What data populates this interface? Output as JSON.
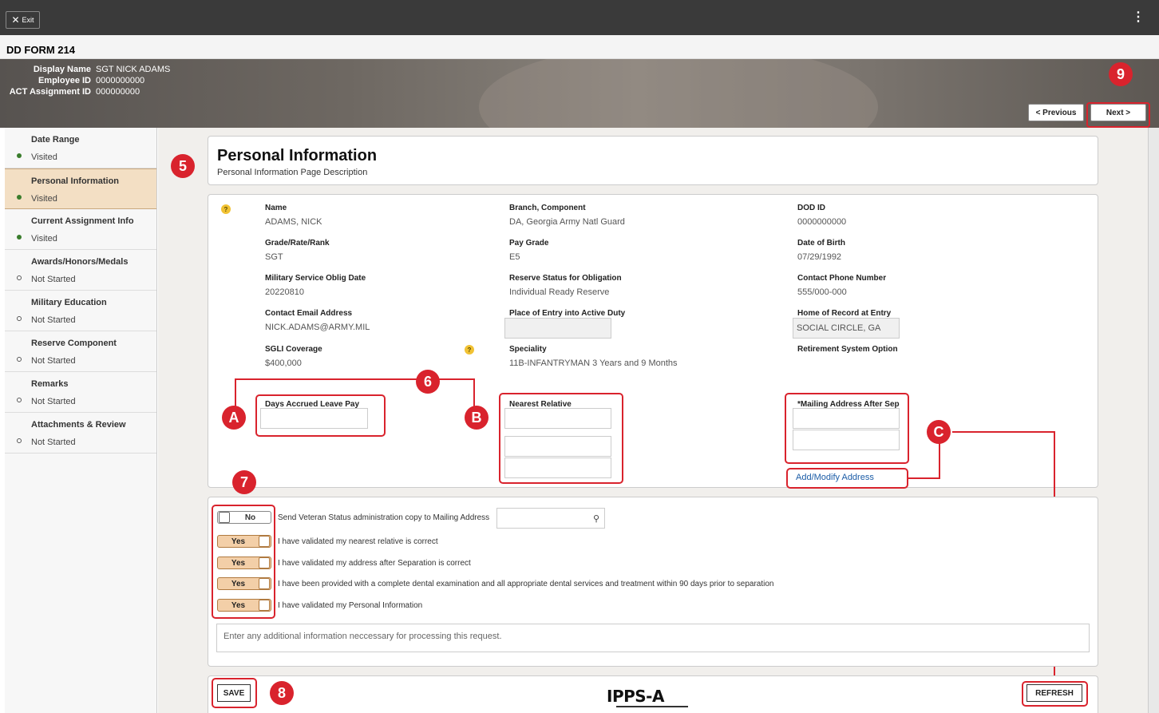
{
  "topbar": {
    "exit_label": "Exit",
    "menu_glyph": "⋮"
  },
  "form_title": "DD FORM 214",
  "employee": {
    "rows": [
      {
        "label": "Display Name",
        "value": "SGT NICK ADAMS"
      },
      {
        "label": "Employee ID",
        "value": "0000000000"
      },
      {
        "label": "ACT Assignment ID",
        "value": "000000000"
      }
    ]
  },
  "nav": {
    "previous_label": "< Previous",
    "next_label": "Next >"
  },
  "steps": [
    {
      "name": "Date Range",
      "status": "Visited"
    },
    {
      "name": "Personal Information",
      "status": "Visited"
    },
    {
      "name": "Current Assignment Info",
      "status": "Visited"
    },
    {
      "name": "Awards/Honors/Medals",
      "status": "Not Started"
    },
    {
      "name": "Military Education",
      "status": "Not Started"
    },
    {
      "name": "Reserve Component",
      "status": "Not Started"
    },
    {
      "name": "Remarks",
      "status": "Not Started"
    },
    {
      "name": "Attachments & Review",
      "status": "Not Started"
    }
  ],
  "page": {
    "title": "Personal Information",
    "description": "Personal Information Page Description"
  },
  "fields": {
    "name": {
      "label": "Name",
      "value": "ADAMS, NICK"
    },
    "branch": {
      "label": "Branch, Component",
      "value": "DA, Georgia Army Natl Guard"
    },
    "dodid": {
      "label": "DOD ID",
      "value": "0000000000"
    },
    "grade": {
      "label": "Grade/Rate/Rank",
      "value": "SGT"
    },
    "paygrade": {
      "label": "Pay Grade",
      "value": "E5"
    },
    "dob": {
      "label": "Date of Birth",
      "value": "07/29/1992"
    },
    "msod": {
      "label": "Military Service Oblig Date",
      "value": "20220810"
    },
    "reserve_status": {
      "label": "Reserve Status for Obligation",
      "value": "Individual Ready Reserve"
    },
    "phone": {
      "label": "Contact Phone Number",
      "value": "555/000-000"
    },
    "email": {
      "label": "Contact Email Address",
      "value": "NICK.ADAMS@ARMY.MIL"
    },
    "place_entry": {
      "label": "Place of Entry into Active Duty",
      "value": ""
    },
    "home_record": {
      "label": "Home of Record at Entry",
      "value": "SOCIAL CIRCLE, GA"
    },
    "sgli": {
      "label": "SGLI Coverage",
      "value": "$400,000"
    },
    "speciality": {
      "label": "Speciality",
      "value": "11B-INFANTRYMAN 3 Years and 9 Months"
    },
    "retirement": {
      "label": "Retirement System Option",
      "value": ""
    },
    "leave": {
      "label": "Days Accrued Leave Pay"
    },
    "relative": {
      "label": "Nearest Relative"
    },
    "mailing": {
      "label": "*Mailing Address After Sep"
    },
    "add_address_link": "Add/Modify Address"
  },
  "checks": [
    {
      "state": "No",
      "label": "Send Veteran Status administration copy to Mailing Address"
    },
    {
      "state": "Yes",
      "label": "I have validated my nearest relative is correct"
    },
    {
      "state": "Yes",
      "label": "I have validated my address after Separation is correct"
    },
    {
      "state": "Yes",
      "label": "I have been provided with a complete dental examination and all appropriate dental services and treatment within 90 days prior to separation"
    },
    {
      "state": "Yes",
      "label": "I have validated my Personal Information"
    }
  ],
  "notes_placeholder": "Enter any additional information neccessary for processing this request.",
  "footer": {
    "save_label": "SAVE",
    "refresh_label": "REFRESH",
    "logo_text": "IPPS-A"
  },
  "annotations": {
    "b5": "5",
    "b6": "6",
    "b7": "7",
    "b8": "8",
    "b9": "9",
    "bA": "A",
    "bB": "B",
    "bC": "C"
  },
  "colors": {
    "annotation": "#d9232d",
    "active_step": "#f3dfc4",
    "toggle_yes": "#f3cfa8",
    "link": "#1a5ba6"
  }
}
